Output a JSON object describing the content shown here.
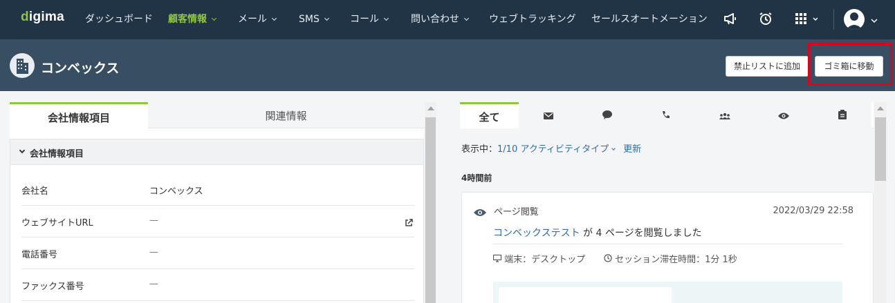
{
  "nav": {
    "logo_prefix": "d",
    "logo_rest": "igima",
    "items": [
      {
        "label": "ダッシュボード",
        "dropdown": false,
        "active": false
      },
      {
        "label": "顧客情報",
        "dropdown": true,
        "active": true
      },
      {
        "label": "メール",
        "dropdown": true,
        "active": false
      },
      {
        "label": "SMS",
        "dropdown": true,
        "active": false
      },
      {
        "label": "コール",
        "dropdown": true,
        "active": false
      },
      {
        "label": "問い合わせ",
        "dropdown": true,
        "active": false
      },
      {
        "label": "ウェブトラッキング",
        "dropdown": false,
        "active": false
      },
      {
        "label": "セールスオートメーション",
        "dropdown": false,
        "active": false
      }
    ],
    "icons": [
      "megaphone-icon",
      "alarm-clock-icon",
      "apps-grid-icon",
      "user-avatar-icon"
    ]
  },
  "header": {
    "company_name": "コンベックス",
    "blacklist_button": "禁止リストに追加",
    "trash_button": "ゴミ箱に移動"
  },
  "left": {
    "tabs": [
      "会社情報項目",
      "関連情報"
    ],
    "section_title": "会社情報項目",
    "fields": [
      {
        "label": "会社名",
        "value": "コンベックス"
      },
      {
        "label": "ウェブサイトURL",
        "value": "—"
      },
      {
        "label": "電話番号",
        "value": "—"
      },
      {
        "label": "ファックス番号",
        "value": "—"
      }
    ]
  },
  "right": {
    "tab_all": "全て",
    "tab_icons": [
      "mail-icon",
      "chat-bubble-icon",
      "phone-icon",
      "group-icon",
      "eye-icon",
      "clipboard-icon"
    ],
    "showing_label": "表示中：",
    "showing_value": "1/10 アクティビティタイプ",
    "refresh": "更新",
    "time_heading": "4時間前",
    "activity": {
      "type": "ページ閲覧",
      "date": "2022/03/29 22:58",
      "link": "コンベックステスト",
      "desc_suffix": " が 4 ページを閲覧しました",
      "device": "端末：デスクトップ",
      "session": "セッション滞在時間：1分 1秒"
    }
  },
  "colors": {
    "nav_bg": "#213446",
    "header_bg": "#384f63",
    "accent_green": "#8dc63f",
    "link_blue": "#2a6db5",
    "highlight_red": "#e3001b"
  }
}
